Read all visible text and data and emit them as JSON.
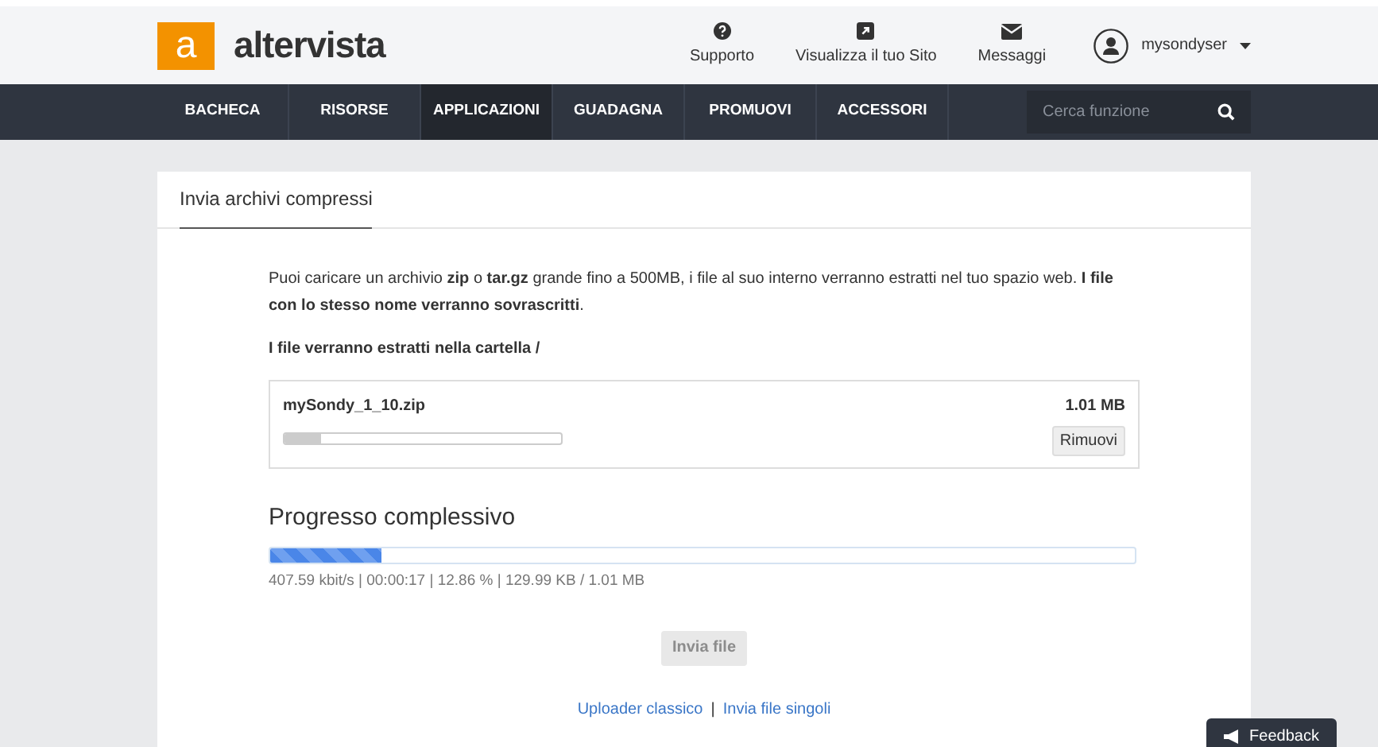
{
  "header": {
    "logo_letter": "a",
    "logo_text": "altervista",
    "links": [
      {
        "kind": "help",
        "label": "Supporto"
      },
      {
        "kind": "external",
        "label": "Visualizza il tuo Sito"
      },
      {
        "kind": "mail",
        "label": "Messaggi"
      }
    ],
    "user": "mysondyser"
  },
  "nav": {
    "items": [
      {
        "label": "BACHECA",
        "selected": false
      },
      {
        "label": "RISORSE",
        "selected": false
      },
      {
        "label": "APPLICAZIONI",
        "selected": true
      },
      {
        "label": "GUADAGNA",
        "selected": false
      },
      {
        "label": "PROMUOVI",
        "selected": false
      },
      {
        "label": "ACCESSORI",
        "selected": false
      }
    ],
    "search_placeholder": "Cerca funzione"
  },
  "card": {
    "title": "Invia archivi compressi",
    "intro": "Puoi caricare un archivio **zip** o **tar.gz** grande fino a 500MB, i file al suo interno verranno estratti nel tuo spazio web. **I file con lo stesso nome verranno sovrascritti**.",
    "folder_note": "I file verranno estratti nella cartella /",
    "file": {
      "name": "mySondy_1_10.zip",
      "size": "1.01 MB",
      "level": 0.13,
      "remove": "Rimuovi"
    },
    "progress": {
      "title": "Progresso complessivo",
      "level": 0.1286,
      "stats": "407.59 kbit/s | 00:00:17 | 12.86 % | 129.99 KB / 1.01 MB"
    },
    "submit": {
      "label": "Invia file",
      "disabled": true
    },
    "links": [
      "Uploader classico",
      "|",
      "Invia file singoli"
    ]
  },
  "feedback": "Feedback"
}
